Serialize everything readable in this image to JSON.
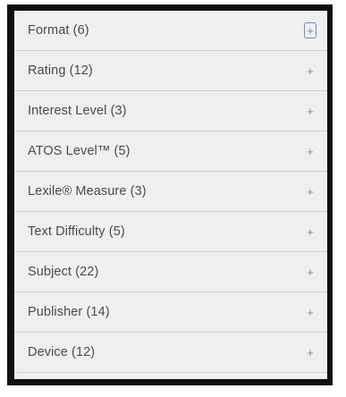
{
  "facets": [
    {
      "label": "Format (6)",
      "icon": "plus-icon",
      "symbol": "+"
    },
    {
      "label": "Rating (12)",
      "icon": "plus-icon",
      "symbol": "+"
    },
    {
      "label": "Interest Level (3)",
      "icon": "plus-icon",
      "symbol": "+"
    },
    {
      "label": "ATOS Level™ (5)",
      "icon": "plus-icon",
      "symbol": "+"
    },
    {
      "label": "Lexile® Measure (3)",
      "icon": "plus-icon",
      "symbol": "+"
    },
    {
      "label": "Text Difficulty (5)",
      "icon": "plus-icon",
      "symbol": "+"
    },
    {
      "label": "Subject (22)",
      "icon": "plus-icon",
      "symbol": "+"
    },
    {
      "label": "Publisher (14)",
      "icon": "plus-icon",
      "symbol": "+"
    },
    {
      "label": "Device (12)",
      "icon": "plus-icon",
      "symbol": "+"
    }
  ],
  "colors": {
    "frame": "#111111",
    "panel": "#efefef",
    "divider": "#d2d2d2",
    "text": "#4a4a4a",
    "icon": "#888888",
    "focus": "#5b8fd6"
  }
}
